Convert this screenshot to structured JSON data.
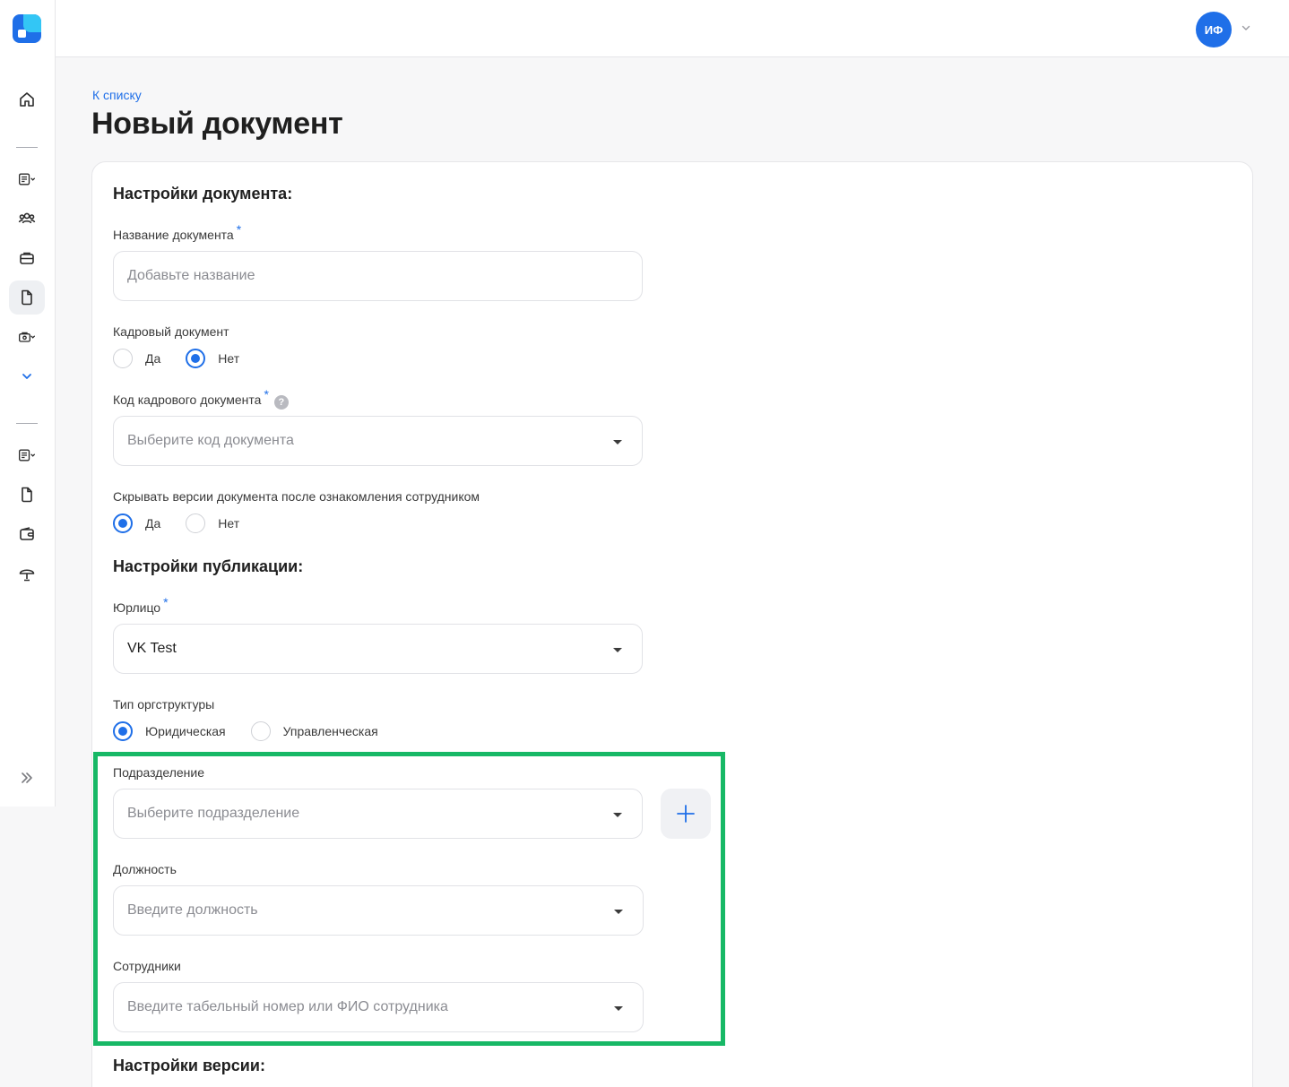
{
  "colors": {
    "accent": "#1f6fe8",
    "highlight": "#17b866"
  },
  "sidebar": {
    "items": [
      {
        "icon": "home-icon"
      },
      {
        "icon": "document-list-icon"
      },
      {
        "icon": "users-icon"
      },
      {
        "icon": "briefcase-icon"
      },
      {
        "icon": "file-icon",
        "active": true
      },
      {
        "icon": "medkit-icon"
      },
      {
        "icon": "chevron-down-icon"
      },
      {
        "icon": "document-list-icon"
      },
      {
        "icon": "file-icon"
      },
      {
        "icon": "wallet-icon"
      },
      {
        "icon": "umbrella-icon"
      }
    ],
    "collapse_icon": "double-chevron-right-icon"
  },
  "header": {
    "avatar_initials": "ИФ"
  },
  "back_link": "К списку",
  "page_title": "Новый документ",
  "doc_settings": {
    "title": "Настройки документа:",
    "name_label": "Название документа",
    "name_placeholder": "Добавьте название",
    "hr_label": "Кадровый документ",
    "hr_yes": "Да",
    "hr_no": "Нет",
    "hr_selected": "Нет",
    "code_label": "Код кадрового документа",
    "code_help": "?",
    "code_placeholder": "Выберите код документа",
    "hide_label": "Скрывать версии документа после ознакомления сотрудником",
    "hide_yes": "Да",
    "hide_no": "Нет",
    "hide_selected": "Да"
  },
  "publication": {
    "title": "Настройки публикации:",
    "entity_label": "Юрлицо",
    "entity_value": "VK Test",
    "org_label": "Тип оргструктуры",
    "org_legal": "Юридическая",
    "org_mgmt": "Управленческая",
    "org_selected": "Юридическая",
    "dept_label": "Подразделение",
    "dept_placeholder": "Выберите подразделение",
    "position_label": "Должность",
    "position_placeholder": "Введите должность",
    "employees_label": "Сотрудники",
    "employees_placeholder": "Введите табельный номер или ФИО сотрудника"
  },
  "required_mark": "*",
  "version": {
    "title": "Настройки версии:"
  }
}
